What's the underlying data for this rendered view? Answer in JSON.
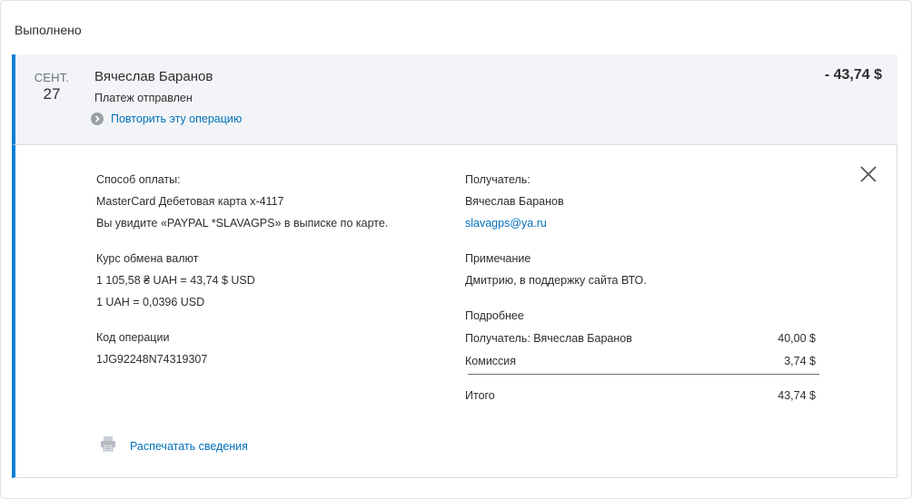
{
  "status_heading": "Выполнено",
  "summary": {
    "date_month": "СЕНТ.",
    "date_day": "27",
    "counterparty": "Вячеслав Баранов",
    "status": "Платеж отправлен",
    "repeat_label": "Повторить эту операцию",
    "amount": "- 43,74 $"
  },
  "details": {
    "payment_method_label": "Способ оплаты:",
    "payment_method_value": "MasterCard Дебетовая карта x-4117",
    "statement_note": "Вы увидите «PAYPAL *SLAVAGPS» в выписке по карте.",
    "exchange_label": "Курс обмена валют",
    "exchange_value": "1 105,58 ₴ UAH = 43,74 $ USD",
    "exchange_rate": "1 UAH = 0,0396 USD",
    "tx_code_label": "Код операции",
    "tx_code_value": "1JG92248N74319307",
    "recipient_label": "Получатель:",
    "recipient_name": "Вячеслав Баранов",
    "recipient_email": "slavagps@ya.ru",
    "note_label": "Примечание",
    "note_value": "Дмитрию, в поддержку сайта ВТО.",
    "more_label": "Подробнее",
    "breakdown": [
      {
        "label": "Получатель: Вячеслав Баранов",
        "value": "40,00 $"
      },
      {
        "label": "Комиссия",
        "value": "3,74 $"
      }
    ],
    "total_label": "Итого",
    "total_value": "43,74 $",
    "print_label": "Распечатать сведения"
  },
  "icons": {
    "repeat": "chevron-right-circle-icon",
    "close": "close-icon",
    "print": "printer-icon"
  },
  "colors": {
    "accent": "#0a7fd8",
    "link": "#0070ba",
    "summary_bg": "#f2f4f7"
  }
}
